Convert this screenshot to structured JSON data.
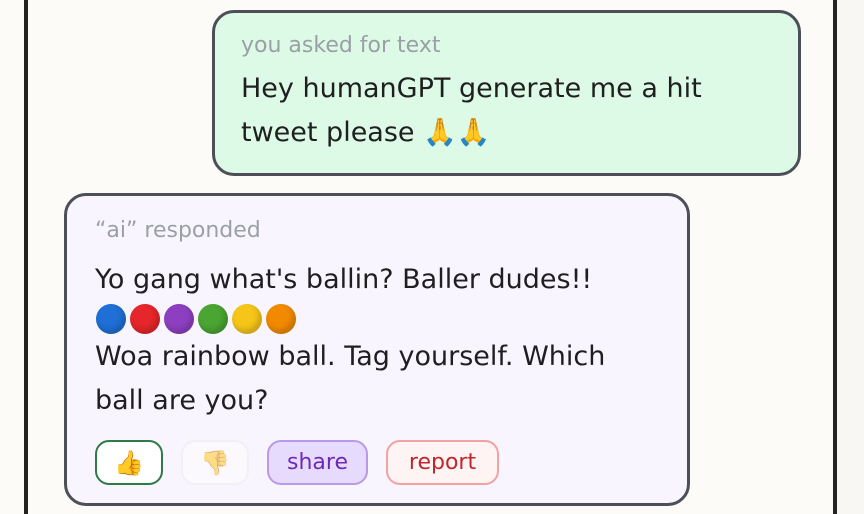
{
  "user_message": {
    "meta": "you asked for text",
    "line1": "Hey humanGPT generate me a hit",
    "line2": "tweet please 🙏🙏"
  },
  "ai_message": {
    "meta": "“ai” responded",
    "line1": "Yo gang what's ballin? Baller dudes!!",
    "balls": [
      "#1f6fd6",
      "#e5262a",
      "#8e3fc1",
      "#4aa532",
      "#f5c518",
      "#f28a00"
    ],
    "line3": "Woa rainbow ball. Tag yourself. Which",
    "line4": "ball are you?"
  },
  "actions": {
    "like_glyph": "👍",
    "dislike_glyph": "👎",
    "share_label": "share",
    "report_label": "report"
  }
}
